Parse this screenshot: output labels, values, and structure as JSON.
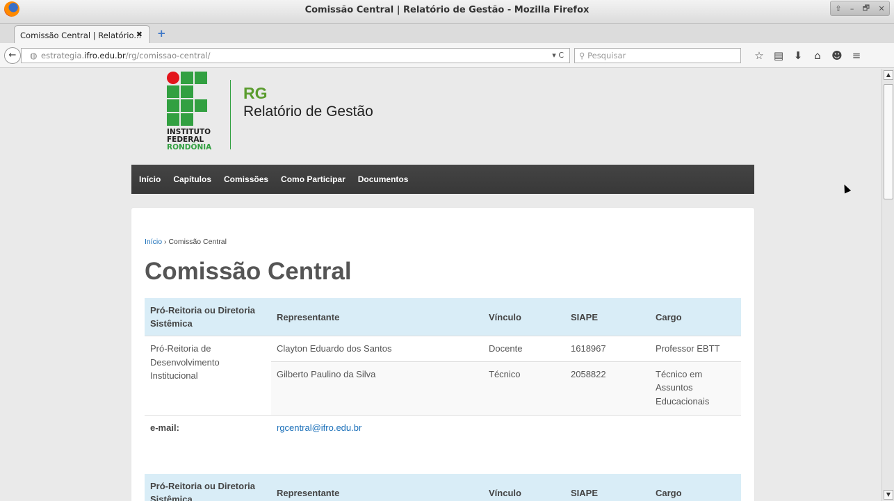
{
  "window": {
    "title": "Comissão Central | Relatório de Gestão - Mozilla Firefox",
    "controls": [
      "⇧",
      "–",
      "🗗",
      "✕"
    ]
  },
  "tabs": [
    {
      "label": "Comissão Central | Relatório...",
      "close": "✖"
    }
  ],
  "newtab_icon": "+",
  "navbar": {
    "url_prefix": "estrategia.",
    "url_host": "ifro.edu.br",
    "url_path": "/rg/comissao-central/",
    "url_controls": "▾ C",
    "search_placeholder": "Pesquisar",
    "search_icon": "🔍"
  },
  "toolbar_icons": [
    "star-icon",
    "reading-list-icon",
    "download-icon",
    "home-icon",
    "chat-icon",
    "menu-icon"
  ],
  "toolbar_glyphs": [
    "☆",
    "▤",
    "⬇",
    "⌂",
    "☻",
    "≡"
  ],
  "site": {
    "logo_lines": [
      "INSTITUTO",
      "FEDERAL",
      "RONDÔNIA"
    ],
    "rg_abbr": "RG",
    "rg_full": "Relatório de Gestão",
    "colors": {
      "green": "#32a041",
      "red": "#e3141b",
      "rg_green": "#5a9c2e",
      "link": "#1a6fb9",
      "header_bg": "#d9edf7"
    }
  },
  "menu": [
    "Início",
    "Capítulos",
    "Comissões",
    "Como Participar",
    "Documentos"
  ],
  "breadcrumb": {
    "home": "Início",
    "sep": " › ",
    "current": "Comissão Central"
  },
  "page_title": "Comissão Central",
  "table": {
    "headers": [
      "Pró-Reitoria ou Diretoria Sistêmica",
      "Representante",
      "Vínculo",
      "SIAPE",
      "Cargo"
    ],
    "unit": "Pró-Reitoria de Desenvolvimento Institucional",
    "rows": [
      {
        "representante": "Clayton Eduardo dos Santos",
        "vinculo": "Docente",
        "siape": "1618967",
        "cargo": "Professor EBTT"
      },
      {
        "representante": "Gilberto Paulino da Silva",
        "vinculo": "Técnico",
        "siape": "2058822",
        "cargo": "Técnico em Assuntos Educacionais"
      }
    ],
    "email_label": "e-mail:",
    "email": "rgcentral@ifro.edu.br"
  },
  "table2": {
    "headers": [
      "Pró-Reitoria ou Diretoria Sistêmica",
      "Representante",
      "Vínculo",
      "SIAPE",
      "Cargo"
    ]
  }
}
